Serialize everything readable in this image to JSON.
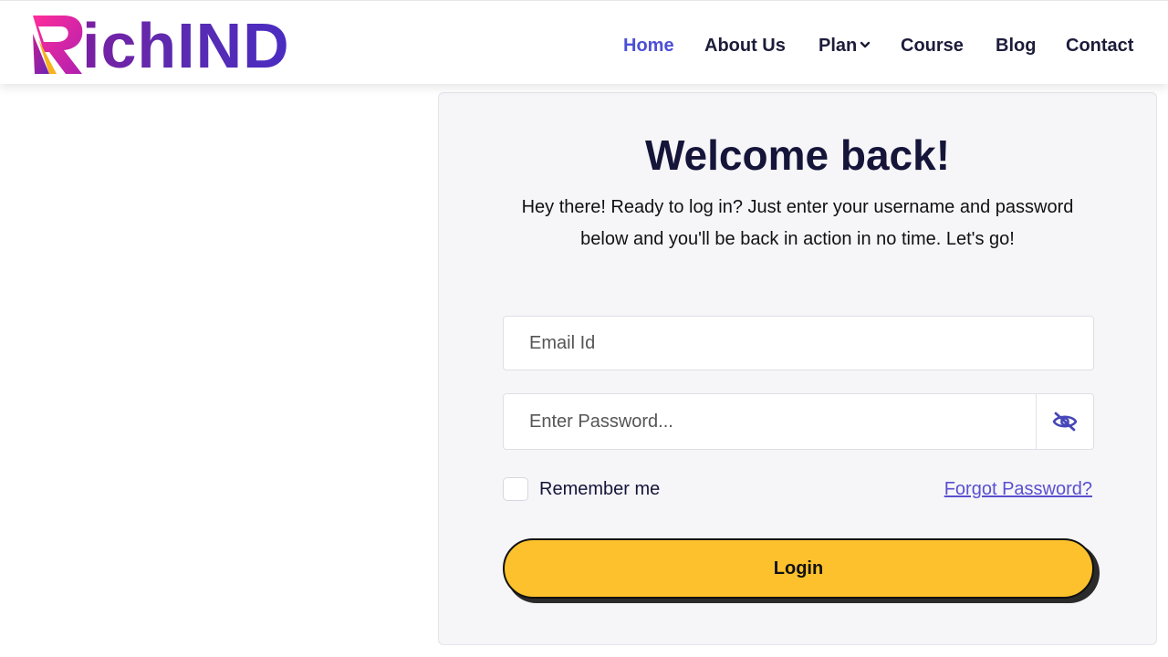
{
  "brand": {
    "logo_text": "RichIND",
    "logo_letter": "R",
    "logo_rest": "ichIND",
    "colors": {
      "accent": "#4c4fd6",
      "gradient_start": "#ff2d9a",
      "gradient_end": "#4a2cc2",
      "logo_swoosh": "#f7b21d"
    }
  },
  "nav": {
    "items": [
      {
        "label": "Home",
        "active": true
      },
      {
        "label": "About Us"
      },
      {
        "label": "Plan",
        "has_dropdown": true,
        "icon": "chevron-down-icon"
      },
      {
        "label": "Course"
      },
      {
        "label": "Blog"
      },
      {
        "label": "Contact"
      }
    ]
  },
  "login": {
    "title": "Welcome back!",
    "subtitle": "Hey there! Ready to log in? Just enter your username and password below and you'll be back in action in no time. Let's go!",
    "email_placeholder": "Email Id",
    "password_placeholder": "Enter Password...",
    "password_toggle_icon": "eye-slash-icon",
    "remember_label": "Remember me",
    "forgot_label": "Forgot Password?",
    "submit_label": "Login",
    "colors": {
      "button": "#fcc12c",
      "card_bg": "#f6f6f9",
      "title": "#15153a",
      "link": "#5a4fcf"
    }
  }
}
